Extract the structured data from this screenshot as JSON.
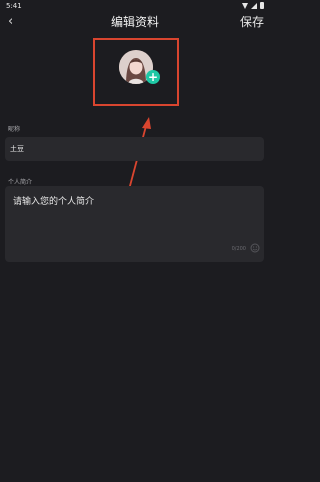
{
  "status_bar": {
    "time": "5:41"
  },
  "header": {
    "back_label": "‹",
    "title": "编辑资料",
    "save_label": "保存"
  },
  "avatar": {
    "add_icon": "plus-icon",
    "accent_color": "#1ec8a5",
    "highlight_color": "#d9452f"
  },
  "form": {
    "nickname_label": "昵称",
    "nickname_value": "土豆",
    "bio_label": "个人简介",
    "bio_placeholder": "请输入您的个人简介",
    "bio_counter": "0/200"
  }
}
